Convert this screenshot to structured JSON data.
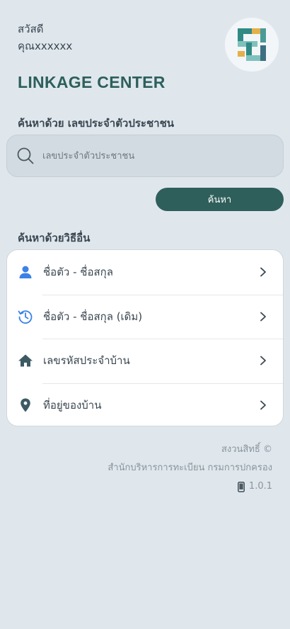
{
  "greeting": {
    "line1": "สวัสดี",
    "line2": "คุณxxxxxx"
  },
  "app_title": "LINKAGE CENTER",
  "search_section": {
    "title": "ค้นหาด้วย เลขประจำตัวประชาชน",
    "placeholder": "เลขประจำตัวประชาชน",
    "button_label": "ค้นหา"
  },
  "other_section": {
    "title": "ค้นหาด้วยวิธีอื่น",
    "items": [
      {
        "label": "ชื่อตัว - ชื่อสกุล",
        "icon": "person-icon"
      },
      {
        "label": "ชื่อตัว - ชื่อสกุล (เดิม)",
        "icon": "history-icon"
      },
      {
        "label": "เลขรหัสประจำบ้าน",
        "icon": "home-icon"
      },
      {
        "label": "ที่อยู่ของบ้าน",
        "icon": "location-pin-icon"
      }
    ]
  },
  "footer": {
    "copyright": "สงวนสิทธิ์ ©",
    "org": "สำนักบริหารการทะเบียน กรมการปกครอง",
    "version": "1.0.1"
  },
  "colors": {
    "background": "#dfe7ed",
    "primary": "#2f5f5b",
    "person_icon": "#3b82e6",
    "history_icon": "#3b82e6",
    "home_icon": "#3d5a63",
    "pin_icon": "#3d5a63"
  }
}
